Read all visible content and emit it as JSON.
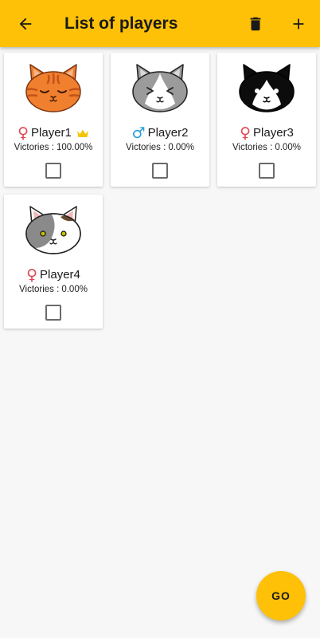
{
  "topbar": {
    "title": "List of players",
    "back_icon": "arrow-left-icon",
    "delete_icon": "trash-icon",
    "add_icon": "plus-icon",
    "color": "#fec107"
  },
  "victories_label": "Victories :",
  "players": [
    {
      "name": "Player1",
      "sex": "♀",
      "gender": "female",
      "victories": "100.00%",
      "leader": true,
      "avatar": "orange-tabby-cat-icon"
    },
    {
      "name": "Player2",
      "sex": "♂",
      "gender": "male",
      "victories": "0.00%",
      "leader": false,
      "avatar": "grey-white-cat-icon"
    },
    {
      "name": "Player3",
      "sex": "♀",
      "gender": "female",
      "victories": "0.00%",
      "leader": false,
      "avatar": "black-white-cat-icon"
    },
    {
      "name": "Player4",
      "sex": "♀",
      "gender": "female",
      "victories": "0.00%",
      "leader": false,
      "avatar": "calico-cat-icon"
    }
  ],
  "go_button": {
    "label": "GO"
  }
}
